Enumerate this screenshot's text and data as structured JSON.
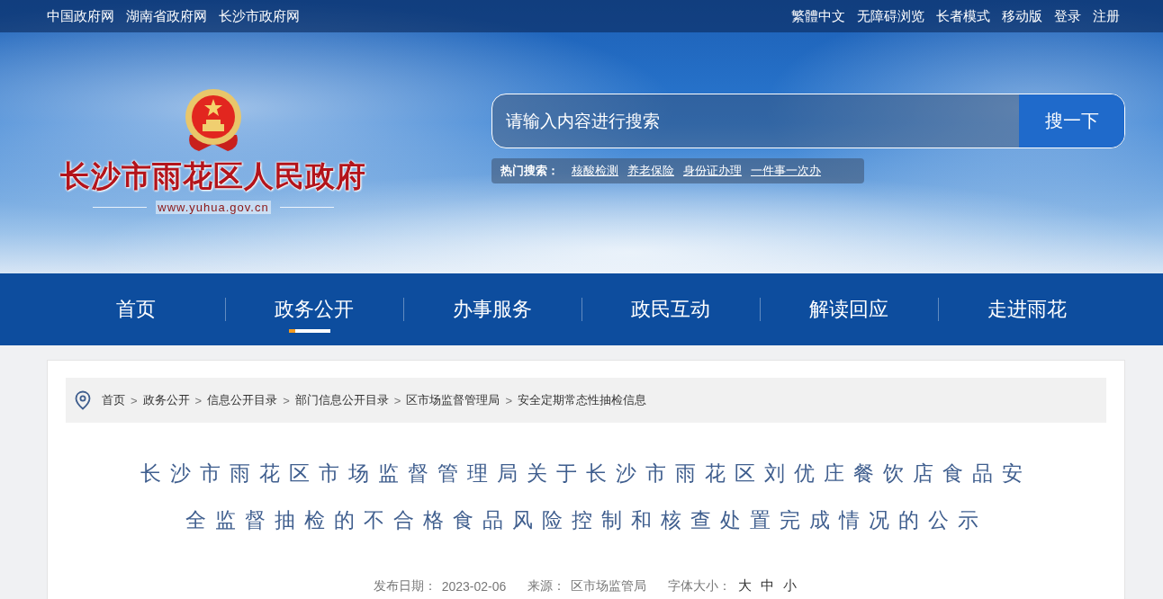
{
  "top_bar": {
    "left_links": [
      "中国政府网",
      "湖南省政府网",
      "长沙市政府网"
    ],
    "right_links": [
      "繁體中文",
      "无障碍浏览",
      "长者模式",
      "移动版",
      "登录",
      "注册"
    ]
  },
  "logo": {
    "title": "长沙市雨花区人民政府",
    "url": "www.yuhua.gov.cn"
  },
  "search": {
    "placeholder": "请输入内容进行搜索",
    "button": "搜一下",
    "hot_label": "热门搜索：",
    "hot_terms": [
      "核酸检测",
      "养老保险",
      "身份证办理",
      "一件事一次办"
    ]
  },
  "nav": [
    {
      "label": "首页",
      "selected": false
    },
    {
      "label": "政务公开",
      "selected": true
    },
    {
      "label": "办事服务",
      "selected": false
    },
    {
      "label": "政民互动",
      "selected": false
    },
    {
      "label": "解读回应",
      "selected": false
    },
    {
      "label": "走进雨花",
      "selected": false
    }
  ],
  "breadcrumb": {
    "separator": ">",
    "items": [
      "首页",
      "政务公开",
      "信息公开目录",
      "部门信息公开目录",
      "区市场监督管理局",
      "安全定期常态性抽检信息"
    ]
  },
  "article": {
    "title": "长沙市雨花区市场监督管理局关于长沙市雨花区刘优庄餐饮店食品安全监督抽检的不合格食品风险控制和核查处置完成情况的公示",
    "date_label": "发布日期：",
    "date": "2023-02-06",
    "source_label": "来源：",
    "source": "区市场监管局",
    "font_size_label": "字体大小：",
    "font_sizes": [
      "大",
      "中",
      "小"
    ]
  }
}
